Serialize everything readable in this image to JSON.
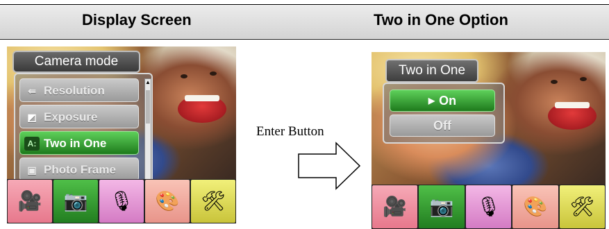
{
  "headers": {
    "left": "Display Screen",
    "right": "Two in One Option"
  },
  "left_screen": {
    "menu_title": "Camera mode",
    "items": [
      {
        "label": "Resolution",
        "icon": "resolution-icon",
        "glyph": "⇚"
      },
      {
        "label": "Exposure",
        "icon": "exposure-icon",
        "glyph": "◩"
      },
      {
        "label": "Two in One",
        "icon": "two-in-one-icon",
        "glyph": "A:"
      },
      {
        "label": "Photo Frame",
        "icon": "photo-frame-icon",
        "glyph": "▣"
      }
    ],
    "selected_item": "Two in One"
  },
  "middle": {
    "enter_label": "Enter Button"
  },
  "right_screen": {
    "popup_title": "Two in One",
    "options": [
      {
        "label": "On",
        "selected": true
      },
      {
        "label": "Off",
        "selected": false
      }
    ]
  },
  "dock": [
    {
      "name": "video-mode-icon",
      "glyph": "🎥",
      "color": "#f6a9b6"
    },
    {
      "name": "camera-mode-icon",
      "glyph": "📷",
      "color": "#4fbf48"
    },
    {
      "name": "voice-record-icon",
      "glyph": "🎙",
      "color": "#f3b7e6"
    },
    {
      "name": "effects-palette-icon",
      "glyph": "🎨",
      "color": "#f9c3b6"
    },
    {
      "name": "setup-tools-icon",
      "glyph": "🛠",
      "color": "#f1f07a"
    }
  ],
  "colors": {
    "selected_green": "#2e9a2b",
    "menu_gray": "#a8a8a8"
  }
}
